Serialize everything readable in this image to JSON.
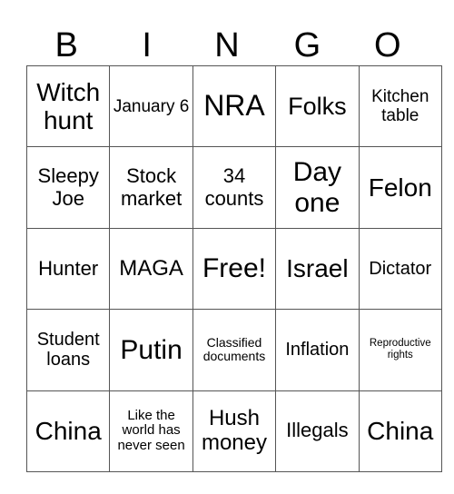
{
  "header": [
    "B",
    "I",
    "N",
    "G",
    "O"
  ],
  "rows": [
    [
      "Witch hunt",
      "January 6",
      "NRA",
      "Folks",
      "Kitchen table"
    ],
    [
      "Sleepy Joe",
      "Stock market",
      "34 counts",
      "Day one",
      "Felon"
    ],
    [
      "Hunter",
      "MAGA",
      "Free!",
      "Israel",
      "Dictator"
    ],
    [
      "Student loans",
      "Putin",
      "Classified documents",
      "Inflation",
      "Reproductive rights"
    ],
    [
      "China",
      "Like the world has never seen",
      "Hush money",
      "Illegals",
      "China"
    ]
  ]
}
